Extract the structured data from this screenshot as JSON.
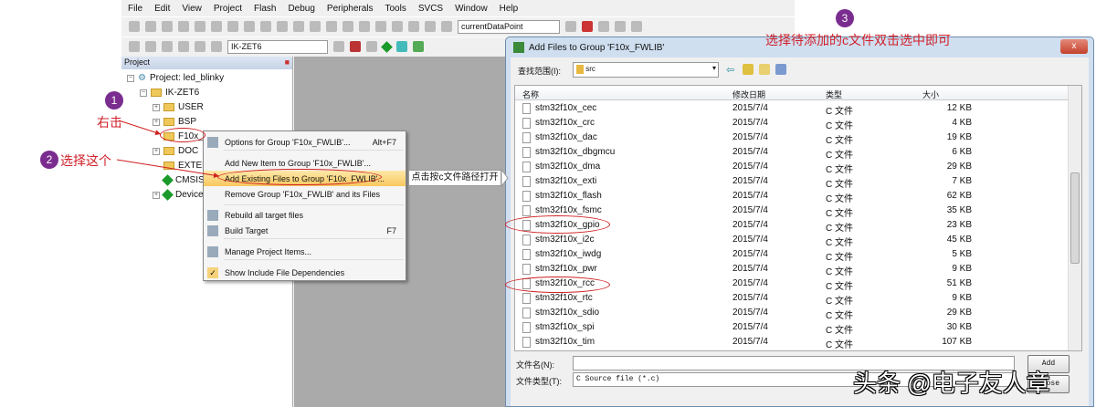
{
  "menu": [
    "File",
    "Edit",
    "View",
    "Project",
    "Flash",
    "Debug",
    "Peripherals",
    "Tools",
    "SVCS",
    "Window",
    "Help"
  ],
  "toolbar": {
    "find_combo": "currentDataPoint",
    "target_combo": "IK-ZET6"
  },
  "project": {
    "title": "Project",
    "root": "Project: led_blinky",
    "target": "IK-ZET6",
    "groups": [
      "USER",
      "BSP",
      "F10x_FWLIB",
      "DOC",
      "EXTER",
      "CMSIS",
      "Device"
    ]
  },
  "context_menu": {
    "items": [
      {
        "label": "Options for Group 'F10x_FWLIB'...",
        "shortcut": "Alt+F7"
      },
      {
        "label": "Add New  Item to Group 'F10x_FWLIB'...",
        "shortcut": ""
      },
      {
        "label": "Add Existing Files to Group 'F10x_FWLIB'...",
        "shortcut": ""
      },
      {
        "label": "Remove Group 'F10x_FWLIB' and its Files",
        "shortcut": ""
      },
      {
        "label": "Rebuild all target files",
        "shortcut": ""
      },
      {
        "label": "Build Target",
        "shortcut": "F7"
      },
      {
        "label": "Manage Project Items...",
        "shortcut": ""
      },
      {
        "label": "Show Include File Dependencies",
        "shortcut": ""
      }
    ]
  },
  "dialog": {
    "title": "Add Files to Group 'F10x_FWLIB'",
    "close": "x",
    "look_in_label": "查找范围(I):",
    "look_in_value": "src",
    "columns": [
      "名称",
      "修改日期",
      "类型",
      "大小"
    ],
    "files": [
      [
        "stm32f10x_cec",
        "2015/7/4",
        "C 文件",
        "12 KB"
      ],
      [
        "stm32f10x_crc",
        "2015/7/4",
        "C 文件",
        "4 KB"
      ],
      [
        "stm32f10x_dac",
        "2015/7/4",
        "C 文件",
        "19 KB"
      ],
      [
        "stm32f10x_dbgmcu",
        "2015/7/4",
        "C 文件",
        "6 KB"
      ],
      [
        "stm32f10x_dma",
        "2015/7/4",
        "C 文件",
        "29 KB"
      ],
      [
        "stm32f10x_exti",
        "2015/7/4",
        "C 文件",
        "7 KB"
      ],
      [
        "stm32f10x_flash",
        "2015/7/4",
        "C 文件",
        "62 KB"
      ],
      [
        "stm32f10x_fsmc",
        "2015/7/4",
        "C 文件",
        "35 KB"
      ],
      [
        "stm32f10x_gpio",
        "2015/7/4",
        "C 文件",
        "23 KB"
      ],
      [
        "stm32f10x_i2c",
        "2015/7/4",
        "C 文件",
        "45 KB"
      ],
      [
        "stm32f10x_iwdg",
        "2015/7/4",
        "C 文件",
        "5 KB"
      ],
      [
        "stm32f10x_pwr",
        "2015/7/4",
        "C 文件",
        "9 KB"
      ],
      [
        "stm32f10x_rcc",
        "2015/7/4",
        "C 文件",
        "51 KB"
      ],
      [
        "stm32f10x_rtc",
        "2015/7/4",
        "C 文件",
        "9 KB"
      ],
      [
        "stm32f10x_sdio",
        "2015/7/4",
        "C 文件",
        "29 KB"
      ],
      [
        "stm32f10x_spi",
        "2015/7/4",
        "C 文件",
        "30 KB"
      ],
      [
        "stm32f10x_tim",
        "2015/7/4",
        "C 文件",
        "107 KB"
      ]
    ],
    "filename_label": "文件名(N):",
    "filename_value": "",
    "filetype_label": "文件类型(T):",
    "filetype_value": "C Source file (*.c)",
    "add_button": "Add",
    "close_button": "Close"
  },
  "annotations": {
    "step1": "1",
    "step1_text": "右击",
    "step2": "2",
    "step2_text": "选择这个",
    "callout": "点击按c文件路径打开",
    "step3": "3",
    "step3_text": "选择待添加的c文件双击选中即可"
  },
  "watermark": "头条 @电子友人章",
  "colors": {
    "annotation": "#d0202a",
    "step_badge": "#7a2c8f"
  }
}
